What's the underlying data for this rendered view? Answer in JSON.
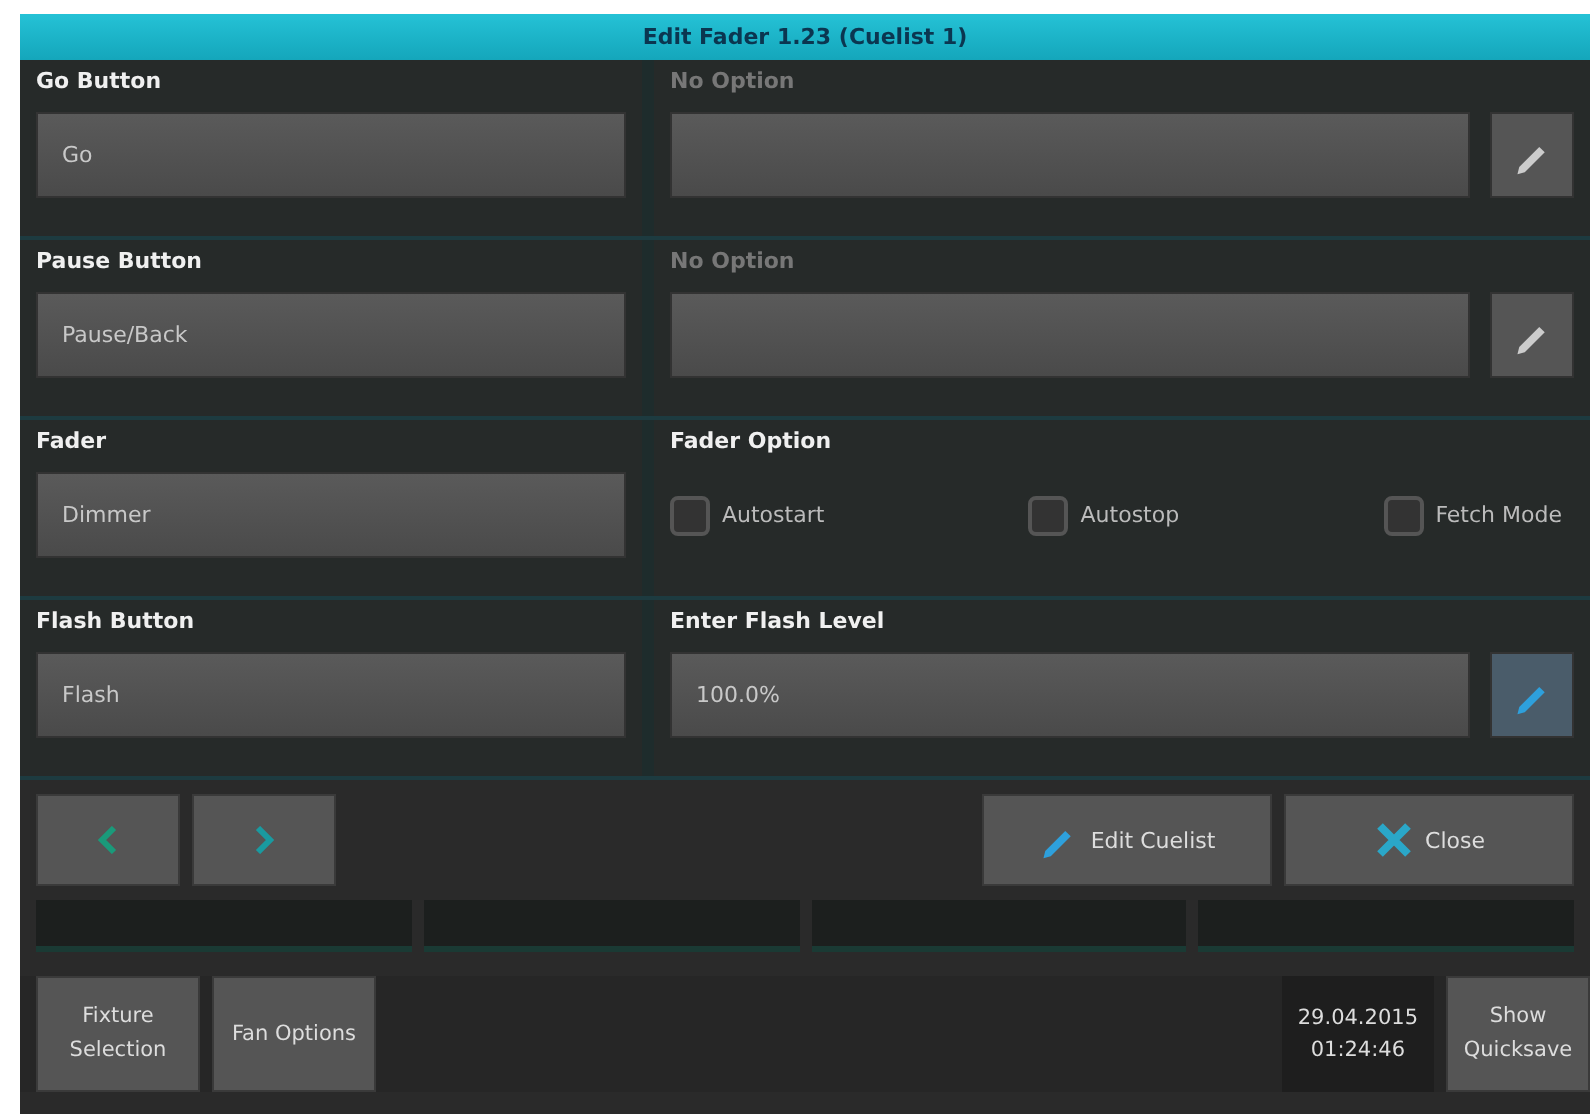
{
  "window": {
    "title": "Edit Fader 1.23 (Cuelist 1)"
  },
  "sections": [
    {
      "left": {
        "label": "Go Button",
        "value": "Go"
      },
      "right": {
        "kind": "select",
        "label": "No Option",
        "disabled": true,
        "edit_active": false
      }
    },
    {
      "left": {
        "label": "Pause Button",
        "value": "Pause/Back"
      },
      "right": {
        "kind": "select",
        "label": "No Option",
        "disabled": true,
        "edit_active": false
      }
    },
    {
      "left": {
        "label": "Fader",
        "value": "Dimmer"
      },
      "right": {
        "kind": "checkboxes",
        "label": "Fader Option",
        "disabled": false,
        "options": [
          {
            "label": "Autostart",
            "checked": false
          },
          {
            "label": "Autostop",
            "checked": false
          },
          {
            "label": "Fetch Mode",
            "checked": false
          }
        ]
      }
    },
    {
      "left": {
        "label": "Flash Button",
        "value": "Flash"
      },
      "right": {
        "kind": "input",
        "label": "Enter Flash Level",
        "disabled": false,
        "value": "100.0%",
        "edit_active": true
      }
    }
  ],
  "nav_buttons": [
    {
      "kind": "prev"
    },
    {
      "kind": "next"
    }
  ],
  "actions": [
    {
      "kind": "edit",
      "label": "Edit Cuelist"
    },
    {
      "kind": "close",
      "label": "Close"
    }
  ],
  "taskbar": {
    "buttons": [
      {
        "label": "Fixture Selection"
      },
      {
        "label": "Fan Options"
      }
    ],
    "date": "29.04.2015",
    "time": "01:24:46",
    "end_button": {
      "label": "Show Quicksave"
    }
  }
}
